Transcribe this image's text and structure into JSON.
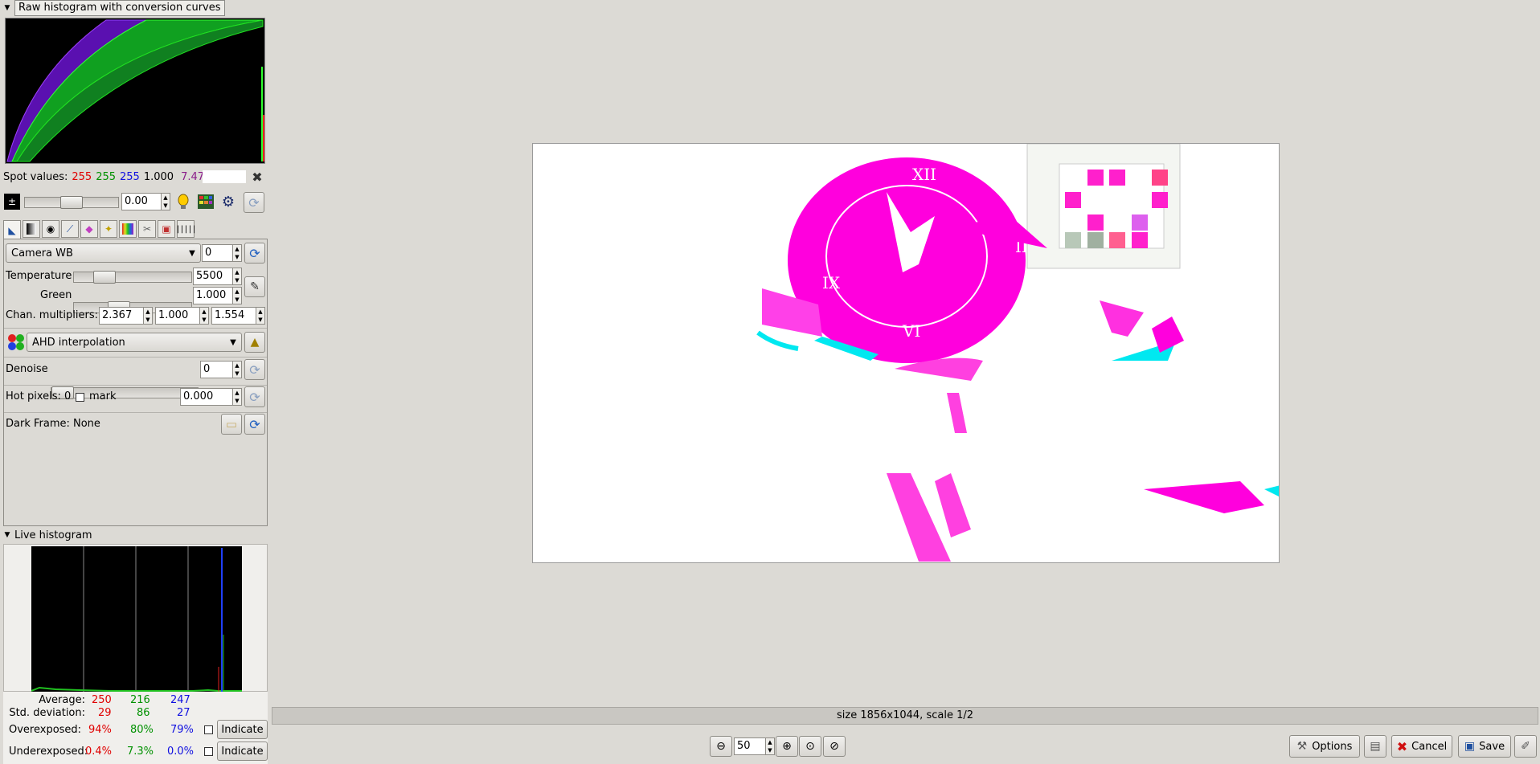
{
  "raw_histogram": {
    "title": "Raw histogram with conversion curves"
  },
  "spot_values": {
    "label": "Spot values:",
    "r": "255",
    "g": "255",
    "b": "255",
    "l": "1.000",
    "ev": "7.47",
    "colors": {
      "r": "#e00000",
      "g": "#009100",
      "b": "#1010e0",
      "ev": "#8a1c8a"
    }
  },
  "exposure": {
    "value": "0.00"
  },
  "white_balance": {
    "preset": "Camera WB",
    "fine_tune": "0",
    "temperature_label": "Temperature",
    "temperature_value": "5500",
    "green_label": "Green",
    "green_value": "1.000",
    "chan_label": "Chan. multipliers:",
    "chan_r": "2.367",
    "chan_g": "1.000",
    "chan_b": "1.554"
  },
  "interpolation": {
    "value": "AHD interpolation"
  },
  "denoise": {
    "label": "Denoise",
    "value": "0"
  },
  "hot_pixels": {
    "label": "Hot pixels: 0",
    "mark_label": "mark",
    "value": "0.000"
  },
  "dark_frame": {
    "label": "Dark Frame:",
    "value": "None"
  },
  "live_histogram": {
    "title": "Live histogram",
    "average_label": "Average:",
    "average": [
      "250",
      "216",
      "247"
    ],
    "stddev_label": "Std. deviation:",
    "stddev": [
      "29",
      "86",
      "27"
    ],
    "overexposed_label": "Overexposed:",
    "overexposed": [
      "94%",
      "80%",
      "79%"
    ],
    "underexposed_label": "Underexposed:",
    "underexposed": [
      "0.4%",
      "7.3%",
      "0.0%"
    ],
    "indicate_label": "Indicate"
  },
  "status": {
    "text": "size 1856x1044, scale 1/2"
  },
  "zoom": {
    "value": "50"
  },
  "actions": {
    "options": "Options",
    "cancel": "Cancel",
    "save": "Save"
  }
}
